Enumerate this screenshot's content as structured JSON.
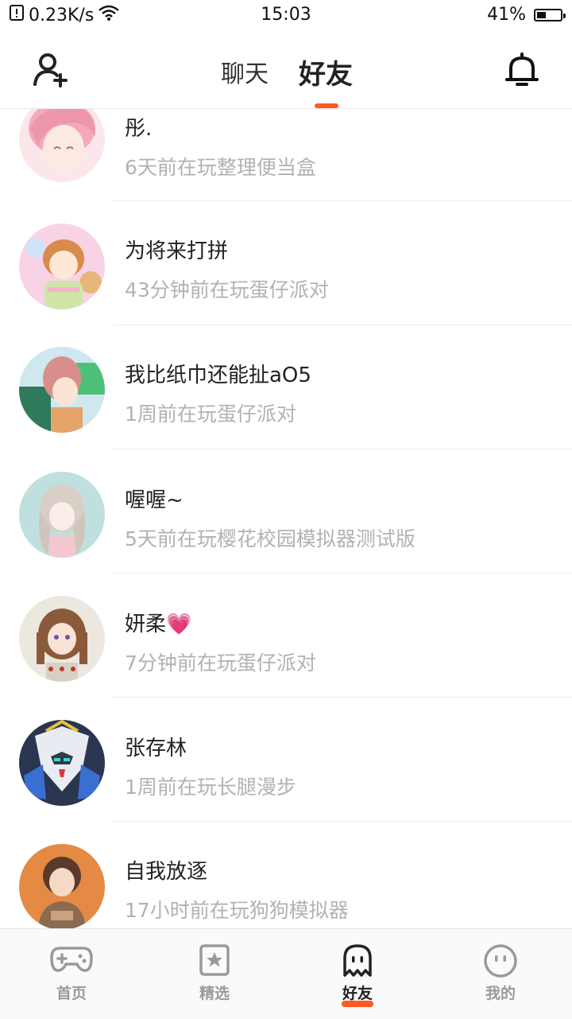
{
  "status_bar": {
    "speed": "0.23K/s",
    "time": "15:03",
    "battery": "41%",
    "battery_level": 0.41
  },
  "header": {
    "tabs": [
      {
        "label": "聊天",
        "active": false
      },
      {
        "label": "好友",
        "active": true
      }
    ],
    "accent_color": "#ff5a1f"
  },
  "friends": [
    {
      "name": "彤.",
      "status": "6天前在玩整理便当盒",
      "avatar_color": "#f6c8d2"
    },
    {
      "name": "为将来打拼",
      "status": "43分钟前在玩蛋仔派对",
      "avatar_color": "#f7d6e6"
    },
    {
      "name": "我比纸巾还能扯aO5",
      "status": "1周前在玩蛋仔派对",
      "avatar_color": "#d9a7a1"
    },
    {
      "name": "喔喔~",
      "status": "5天前在玩樱花校园模拟器测试版",
      "avatar_color": "#bfe0de"
    },
    {
      "name": "妍柔💗",
      "status": "7分钟前在玩蛋仔派对",
      "avatar_color": "#ece7df"
    },
    {
      "name": "张存林",
      "status": "1周前在玩长腿漫步",
      "avatar_color": "#3a4a6a"
    },
    {
      "name": "自我放逐",
      "status": "17小时前在玩狗狗模拟器",
      "avatar_color": "#e58a45"
    }
  ],
  "bottom_nav": [
    {
      "label": "首页",
      "icon": "gamepad-icon",
      "active": false
    },
    {
      "label": "精选",
      "icon": "star-book-icon",
      "active": false
    },
    {
      "label": "好友",
      "icon": "ghost-icon",
      "active": true
    },
    {
      "label": "我的",
      "icon": "face-icon",
      "active": false
    }
  ]
}
